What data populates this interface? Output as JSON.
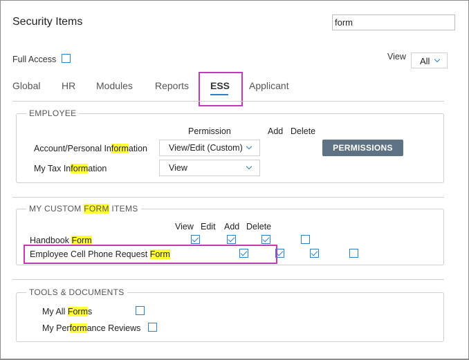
{
  "header": {
    "title": "Security Items",
    "search_value": "form"
  },
  "full_access": {
    "label": "Full Access",
    "checked": false
  },
  "view_filter": {
    "label": "View",
    "value": "All"
  },
  "tabs": [
    {
      "label": "Global"
    },
    {
      "label": "HR"
    },
    {
      "label": "Modules"
    },
    {
      "label": "Reports"
    },
    {
      "label": "ESS",
      "active": true
    },
    {
      "label": "Applicant"
    }
  ],
  "employee": {
    "legend": "EMPLOYEE",
    "col_permission": "Permission",
    "col_add": "Add",
    "col_delete": "Delete",
    "rows": [
      {
        "label_pre": "Account/Personal In",
        "label_hl": "form",
        "label_post": "ation",
        "permission": "View/Edit (Custom)"
      },
      {
        "label_pre": "My Tax In",
        "label_hl": "form",
        "label_post": "ation",
        "permission": "View"
      }
    ],
    "permissions_button": "PERMISSIONS"
  },
  "custom_forms": {
    "legend_pre": "MY CUSTOM ",
    "legend_hl": "FORM",
    "legend_post": " ITEMS",
    "col_view": "View",
    "col_edit": "Edit",
    "col_add": "Add",
    "col_delete": "Delete",
    "rows": [
      {
        "label_pre": "Handbook ",
        "label_hl": "Form",
        "view": true,
        "edit": true,
        "add": true,
        "delete": false
      },
      {
        "label_pre": "Employee Cell Phone Request ",
        "label_hl": "Form",
        "view": true,
        "edit": true,
        "add": true,
        "delete": false
      }
    ]
  },
  "tools": {
    "legend": "TOOLS & DOCUMENTS",
    "items": [
      {
        "label_pre": "My All ",
        "label_hl": "Form",
        "label_post": "s",
        "checked": false
      },
      {
        "label_pre": "My Per",
        "label_hl": "form",
        "label_post": "ance Reviews",
        "checked": false
      }
    ]
  },
  "colors": {
    "accent": "#2f7fc4",
    "highlight": "#ffff33",
    "annotation": "#c33bb2",
    "button": "#5f7283"
  }
}
